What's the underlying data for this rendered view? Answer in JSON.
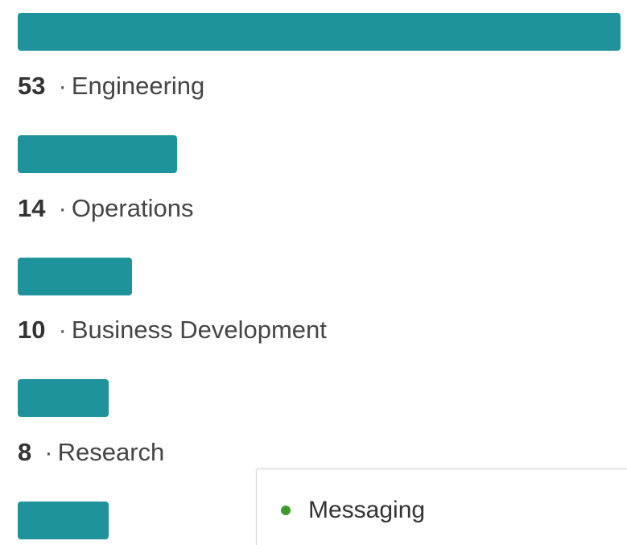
{
  "colors": {
    "bar": "#1f939c",
    "online_dot": "#3e9b2b"
  },
  "departments": [
    {
      "count": "53",
      "separator": "·",
      "name": "Engineering",
      "bar_fraction": 1.0
    },
    {
      "count": "14",
      "separator": "·",
      "name": "Operations",
      "bar_fraction": 0.264
    },
    {
      "count": "10",
      "separator": "·",
      "name": "Business Development",
      "bar_fraction": 0.189
    },
    {
      "count": "8",
      "separator": "·",
      "name": "Research",
      "bar_fraction": 0.151
    },
    {
      "count": "",
      "separator": "",
      "name": "",
      "bar_fraction": 0.151
    }
  ],
  "messaging": {
    "label": "Messaging",
    "status_icon": "online-dot-icon"
  }
}
